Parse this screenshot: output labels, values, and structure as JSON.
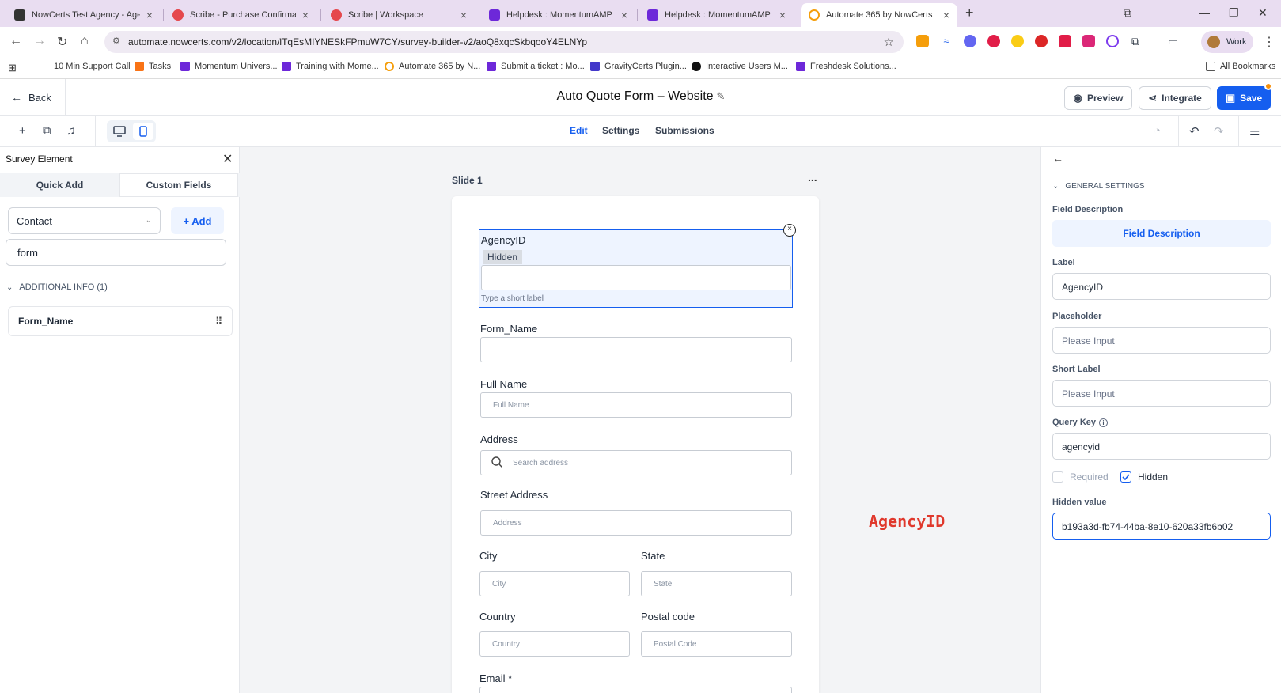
{
  "browser": {
    "tabs": [
      {
        "title": "NowCerts Test Agency - Agency",
        "color": "#333333"
      },
      {
        "title": "Scribe - Purchase Confirmation",
        "color": "#e5484d"
      },
      {
        "title": "Scribe | Workspace",
        "color": "#e5484d"
      },
      {
        "title": "Helpdesk : MomentumAMP",
        "color": "#6d28d9"
      },
      {
        "title": "Helpdesk : MomentumAMP",
        "color": "#6d28d9"
      },
      {
        "title": "Automate 365 by NowCerts",
        "color": "#f59e0b"
      }
    ],
    "url": "automate.nowcerts.com/v2/location/lTqEsMIYNESkFPmuW7CY/survey-builder-v2/aoQ8xqcSkbqooY4ELNYp",
    "profile_label": "Work",
    "bookmarks": [
      "10 Min Support Call",
      "Tasks",
      "Momentum Univers...",
      "Training with Mome...",
      "Automate 365 by N...",
      "Submit a ticket : Mo...",
      "GravityCerts Plugin...",
      "Interactive Users M...",
      "Freshdesk Solutions..."
    ],
    "all_bookmarks": "All Bookmarks"
  },
  "header": {
    "back_label": "Back",
    "form_title": "Auto Quote Form – Website",
    "preview_label": "Preview",
    "integrate_label": "Integrate",
    "save_label": "Save"
  },
  "toolbar": {
    "tabs": [
      "Edit",
      "Settings",
      "Submissions"
    ],
    "active_tab": "Edit"
  },
  "left_panel": {
    "title": "Survey Element",
    "segments": [
      "Quick Add",
      "Custom Fields"
    ],
    "active_segment": "Custom Fields",
    "object_select": "Contact",
    "add_label": "+ Add",
    "search_value": "form",
    "group_title": "ADDITIONAL INFO (1)",
    "fields": [
      "Form_Name"
    ]
  },
  "canvas": {
    "slide_label": "Slide 1",
    "more": "...",
    "selected_field": {
      "label": "AgencyID",
      "tag": "Hidden",
      "short_label_hint": "Type a short label"
    },
    "fields": {
      "form_name": {
        "label": "Form_Name",
        "placeholder": ""
      },
      "full_name": {
        "label": "Full Name",
        "placeholder": "Full Name"
      },
      "address": {
        "label": "Address",
        "placeholder": "Search address"
      },
      "street": {
        "label": "Street Address",
        "placeholder": "Address"
      },
      "city": {
        "label": "City",
        "placeholder": "City"
      },
      "state": {
        "label": "State",
        "placeholder": "State"
      },
      "country": {
        "label": "Country",
        "placeholder": "Country"
      },
      "postal": {
        "label": "Postal code",
        "placeholder": "Postal Code"
      },
      "email": {
        "label": "Email *"
      }
    },
    "annotation": "AgencyID"
  },
  "right_panel": {
    "section": "GENERAL SETTINGS",
    "field_description_label": "Field Description",
    "field_description_button": "Field Description",
    "label_label": "Label",
    "label_value": "AgencyID",
    "placeholder_label": "Placeholder",
    "placeholder_value": "Please Input",
    "short_label_label": "Short Label",
    "short_label_value": "Please Input",
    "query_key_label": "Query Key",
    "query_key_value": "agencyid",
    "required_label": "Required",
    "required_checked": false,
    "hidden_label": "Hidden",
    "hidden_checked": true,
    "hidden_value_label": "Hidden value",
    "hidden_value": "b193a3d-fb74-44ba-8e10-620a33fb6b02"
  },
  "colors": {
    "primary": "#155eef",
    "annotation": "#e0382c",
    "tabbar": "#e9ddf1"
  }
}
